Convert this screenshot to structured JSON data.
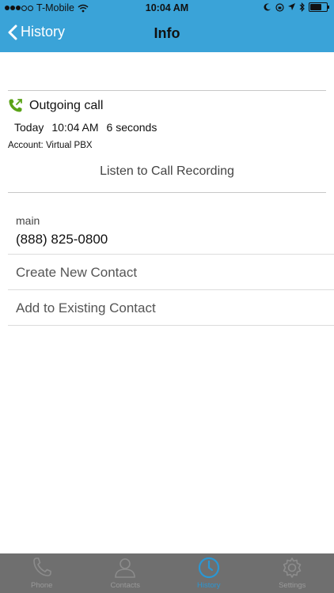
{
  "status_bar": {
    "carrier": "T-Mobile",
    "time": "10:04 AM"
  },
  "nav": {
    "back_label": "History",
    "title": "Info"
  },
  "call": {
    "type_label": "Outgoing call",
    "date": "Today",
    "time": "10:04 AM",
    "duration": "6 seconds",
    "account": "Account: Virtual PBX",
    "listen_label": "Listen to Call Recording"
  },
  "contact": {
    "number_label": "main",
    "number": "(888) 825-0800",
    "create_label": "Create New Contact",
    "add_existing_label": "Add to Existing Contact"
  },
  "tabs": [
    {
      "label": "Phone",
      "icon": "phone-icon",
      "active": false
    },
    {
      "label": "Contacts",
      "icon": "contacts-icon",
      "active": false
    },
    {
      "label": "History",
      "icon": "clock-icon",
      "active": true
    },
    {
      "label": "Settings",
      "icon": "gear-icon",
      "active": false
    }
  ],
  "colors": {
    "header": "#3aa3d8",
    "call_icon": "#5aa317",
    "active_tab": "#2a97d4",
    "tab_bar": "#6f6f6f"
  }
}
